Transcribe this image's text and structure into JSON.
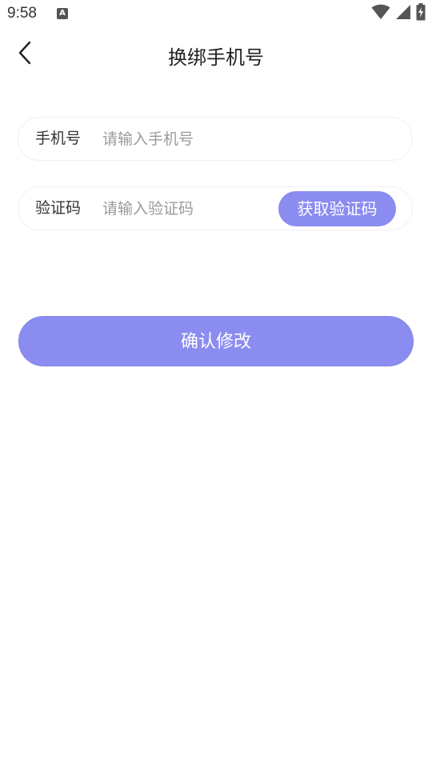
{
  "status_bar": {
    "time": "9:58",
    "notification_icon": "text-a-icon",
    "notification_glyph": "A",
    "icons": [
      "wifi-icon",
      "cell-signal-icon",
      "battery-charging-icon"
    ]
  },
  "header": {
    "title": "换绑手机号",
    "back_icon": "chevron-left-icon"
  },
  "form": {
    "phone": {
      "label": "手机号",
      "value": "",
      "placeholder": "请输入手机号"
    },
    "code": {
      "label": "验证码",
      "value": "",
      "placeholder": "请输入验证码",
      "get_code_label": "获取验证码"
    }
  },
  "confirm_button_label": "确认修改",
  "colors": {
    "accent": "#8a8cf0",
    "text": "#333333",
    "placeholder": "#9a9a9a",
    "field_border": "#f0f0f3"
  }
}
